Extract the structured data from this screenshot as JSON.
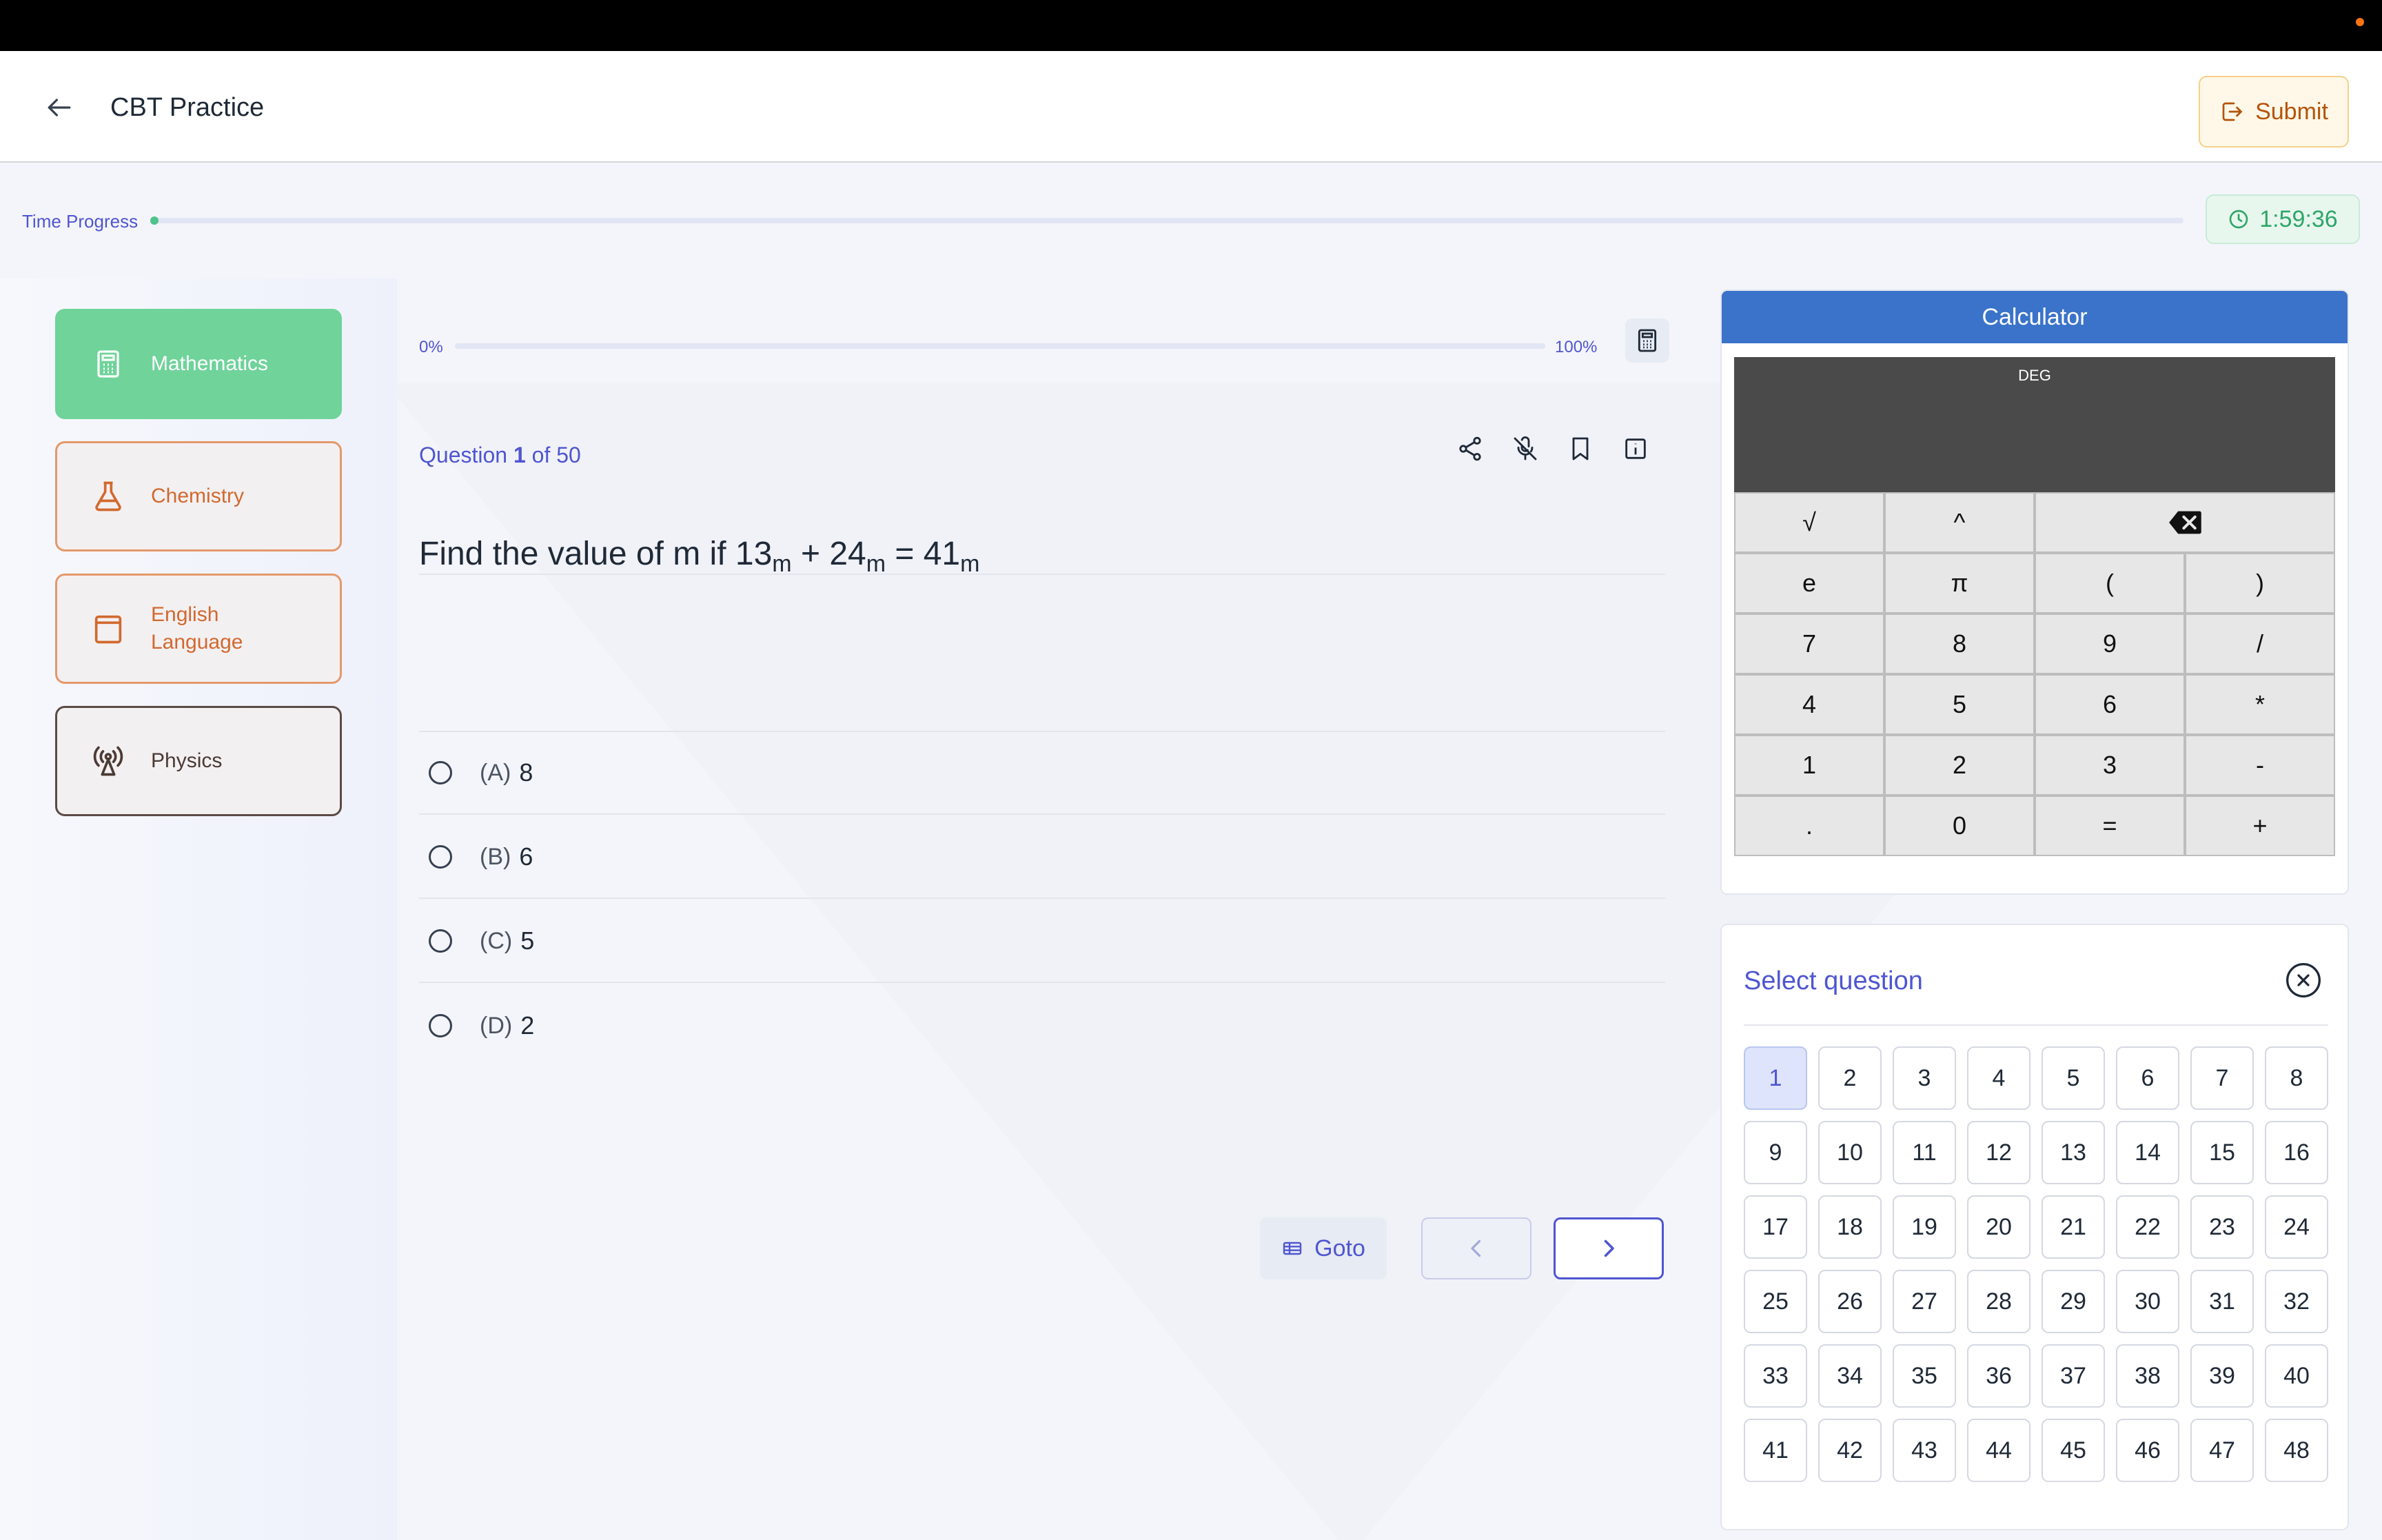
{
  "header": {
    "title": "CBT Practice",
    "submit_label": "Submit"
  },
  "time_progress": {
    "label": "Time Progress",
    "progress_fraction": 0.001,
    "timer": "1:59:36"
  },
  "subjects": [
    {
      "label": "Mathematics",
      "icon": "calculator-icon",
      "state": "active"
    },
    {
      "label": "Chemistry",
      "icon": "flask-icon",
      "state": "normal"
    },
    {
      "label": "English Language",
      "icon": "book-icon",
      "state": "normal"
    },
    {
      "label": "Physics",
      "icon": "antenna-icon",
      "state": "dark"
    }
  ],
  "question_progress": {
    "start_label": "0%",
    "end_label": "100%",
    "progress_fraction": 0.0
  },
  "question": {
    "prefix": "Question",
    "number": "1",
    "of_text": "of 50",
    "text_parts": [
      "Find the value of m if 13",
      "m",
      "  + 24",
      "m",
      " = 41",
      "m"
    ],
    "options": [
      {
        "letter": "(A)",
        "value": "8"
      },
      {
        "letter": "(B)",
        "value": "6"
      },
      {
        "letter": "(C)",
        "value": "5"
      },
      {
        "letter": "(D)",
        "value": "2"
      }
    ],
    "tool_icons": [
      "share-icon",
      "mic-off-icon",
      "bookmark-icon",
      "info-icon"
    ]
  },
  "navigation": {
    "goto_label": "Goto"
  },
  "calculator": {
    "title": "Calculator",
    "mode": "DEG",
    "keys": [
      "√",
      "^",
      "",
      "e",
      "π",
      "(",
      ")",
      "7",
      "8",
      "9",
      "/",
      "4",
      "5",
      "6",
      "*",
      "1",
      "2",
      "3",
      "-",
      ".",
      "0",
      "=",
      "+"
    ]
  },
  "question_selector": {
    "title": "Select question",
    "current": "1",
    "numbers": [
      "1",
      "2",
      "3",
      "4",
      "5",
      "6",
      "7",
      "8",
      "9",
      "10",
      "11",
      "12",
      "13",
      "14",
      "15",
      "16",
      "17",
      "18",
      "19",
      "20",
      "21",
      "22",
      "23",
      "24",
      "25",
      "26",
      "27",
      "28",
      "29",
      "30",
      "31",
      "32",
      "33",
      "34",
      "35",
      "36",
      "37",
      "38",
      "39",
      "40",
      "41",
      "42",
      "43",
      "44",
      "45",
      "46",
      "47",
      "48"
    ]
  },
  "colors": {
    "accent": "#4f56d0",
    "active_subject": "#6fd39a",
    "subject_border": "#e4996a",
    "calculator_header": "#3a73c9",
    "timer_text": "#2fa66a",
    "submit_text": "#b45309"
  }
}
